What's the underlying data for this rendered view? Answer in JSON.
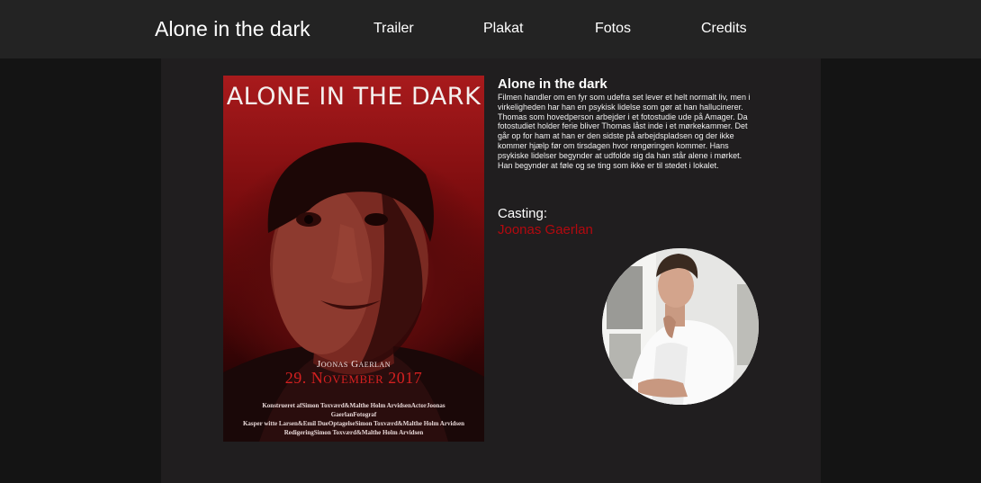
{
  "header": {
    "site_title": "Alone in the dark",
    "nav": [
      "Trailer",
      "Plakat",
      "Fotos",
      "Credits"
    ]
  },
  "poster": {
    "title": "ALONE IN THE DARK",
    "actor": "Joonas Gaerlan",
    "date": "29. November 2017",
    "credits_line1": "Konstrueret afSimon Toxværd&Malthe Holm ArvidsenActorJoonas GaerlanFotograf",
    "credits_line2": "Kasper witte Larsen&Emil DueOptagelseSimon Toxværd&Malthe Holm Arvidsen",
    "credits_line3": "RedigeringSimon Toxværd&Malthe Holm Arvidsen"
  },
  "movie": {
    "title": "Alone in the dark",
    "description": "Filmen handler om en fyr som udefra set lever et helt normalt liv, men i virkeligheden har han en psykisk lidelse som gør at han hallucinerer. Thomas som hovedperson arbejder i et fotostudie ude på Amager. Da fotostudiet holder ferie bliver Thomas låst inde i et mørkekammer. Det går op for ham at han er den sidste på arbejdspladsen og der ikke kommer hjælp før om tirsdagen hvor rengøringen kommer. Hans psykiske lidelser begynder at udfolde sig da han står alene i mørket. Han begynder at føle og se ting som ikke er til stedet i lokalet.",
    "casting_label": "Casting:",
    "cast": [
      "Joonas Gaerlan"
    ]
  },
  "colors": {
    "header_bg": "#232323",
    "page_bg": "#141414",
    "content_bg": "#201e1f",
    "accent_red": "#b3090f"
  }
}
